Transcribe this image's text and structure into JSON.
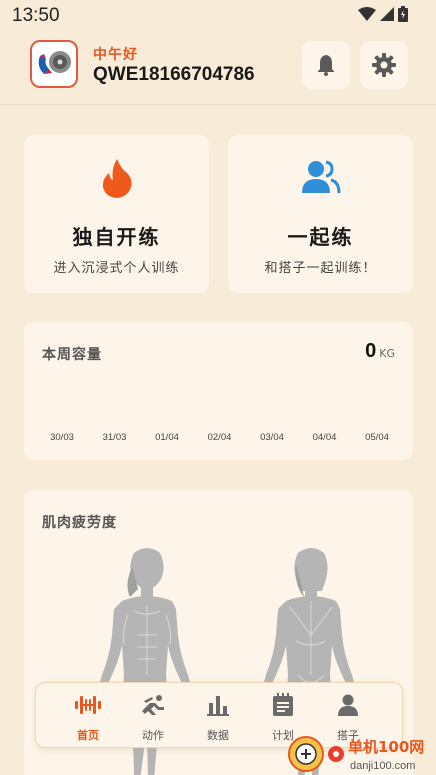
{
  "status": {
    "time": "13:50"
  },
  "header": {
    "greeting": "中午好",
    "username": "QWE18166704786"
  },
  "train_cards": [
    {
      "title": "独自开练",
      "subtitle": "进入沉浸式个人训练",
      "icon": "flame-icon"
    },
    {
      "title": "一起练",
      "subtitle": "和搭子一起训练！",
      "icon": "people-icon"
    }
  ],
  "weekly_volume": {
    "title": "本周容量",
    "value": "0",
    "unit": "KG",
    "dates": [
      "30/03",
      "31/03",
      "01/04",
      "02/04",
      "03/04",
      "04/04",
      "05/04"
    ]
  },
  "fatigue": {
    "title": "肌肉疲劳度"
  },
  "nav": [
    {
      "label": "首页",
      "icon": "dumbbell-icon",
      "active": true
    },
    {
      "label": "动作",
      "icon": "exercise-icon",
      "active": false
    },
    {
      "label": "数据",
      "icon": "chart-icon",
      "active": false
    },
    {
      "label": "计划",
      "icon": "plan-icon",
      "active": false
    },
    {
      "label": "搭子",
      "icon": "partner-icon",
      "active": false
    }
  ],
  "watermark": {
    "text_top": "单机100网",
    "text_bottom": "danji100.com"
  },
  "colors": {
    "accent": "#e8571e",
    "background": "#f8ecd8",
    "card": "#fdf5ea",
    "people_icon": "#2f8fd8",
    "body": "#b5b5b5"
  }
}
